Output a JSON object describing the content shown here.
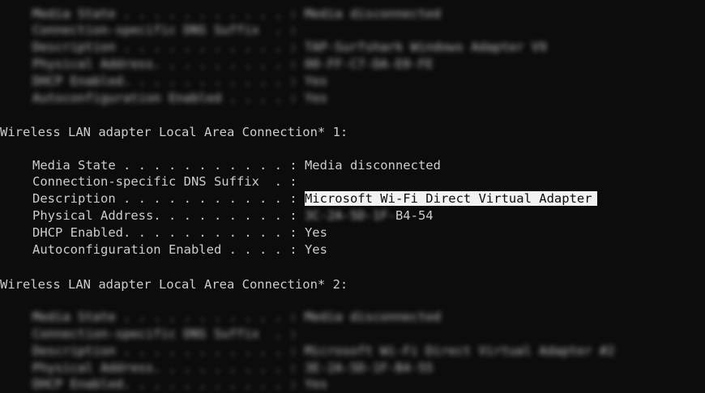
{
  "top_block": {
    "rows": [
      {
        "label": "Media State . . . . . . . . . . . :",
        "value": "Media disconnected"
      },
      {
        "label": "Connection-specific DNS Suffix  . :",
        "value": ""
      },
      {
        "label": "Description . . . . . . . . . . . :",
        "value": "TAP-Surfshark Windows Adapter V9"
      },
      {
        "label": "Physical Address. . . . . . . . . :",
        "value": "00-FF-C7-DA-E0-FE"
      },
      {
        "label": "DHCP Enabled. . . . . . . . . . . :",
        "value": "Yes"
      },
      {
        "label": "Autoconfiguration Enabled . . . . :",
        "value": "Yes"
      }
    ]
  },
  "adapter1": {
    "header": "Wireless LAN adapter Local Area Connection* 1:",
    "media_label": "Media State . . . . . . . . . . . :",
    "media_value": "Media disconnected",
    "dns_label": "Connection-specific DNS Suffix  . :",
    "desc_label": "Description . . . . . . . . . . . :",
    "desc_value": "Microsoft Wi-Fi Direct Virtual Adapter",
    "phys_label": "Physical Address. . . . . . . . . :",
    "phys_redacted": "3C-2A-5D-1F-",
    "phys_value": "B4-54",
    "dhcp_label": "DHCP Enabled. . . . . . . . . . . :",
    "dhcp_value": "Yes",
    "auto_label": "Autoconfiguration Enabled . . . . :",
    "auto_value": "Yes"
  },
  "adapter2": {
    "header": "Wireless LAN adapter Local Area Connection* 2:"
  },
  "bottom_block": {
    "rows": [
      {
        "label": "Media State . . . . . . . . . . . :",
        "value": "Media disconnected"
      },
      {
        "label": "Connection-specific DNS Suffix  . :",
        "value": ""
      },
      {
        "label": "Description . . . . . . . . . . . :",
        "value": "Microsoft Wi-Fi Direct Virtual Adapter #2"
      },
      {
        "label": "Physical Address. . . . . . . . . :",
        "value": "3E-2A-5D-1F-B4-55"
      },
      {
        "label": "DHCP Enabled. . . . . . . . . . . :",
        "value": "Yes"
      }
    ]
  }
}
